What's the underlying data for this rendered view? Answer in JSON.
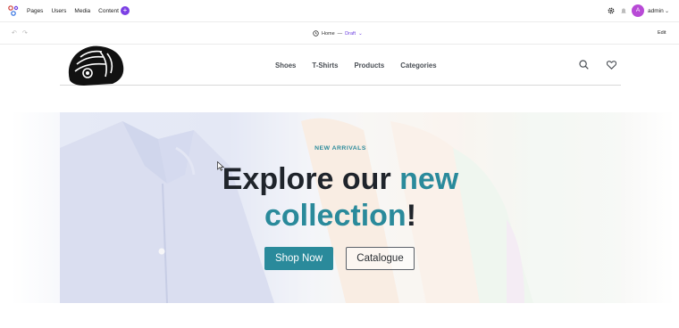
{
  "topbar": {
    "nav": [
      "Pages",
      "Users",
      "Media",
      "Content"
    ],
    "plus_label": "+",
    "avatar_initial": "A",
    "user_label": "admin"
  },
  "editorbar": {
    "page_name": "Home",
    "separator": "—",
    "status": "Draft",
    "edit_label": "Edit"
  },
  "site": {
    "nav": [
      "Shoes",
      "T-Shirts",
      "Products",
      "Categories"
    ]
  },
  "hero": {
    "kicker": "NEW ARRIVALS",
    "headline_part1": "Explore our ",
    "headline_accent1": "new",
    "headline_accent2": "collection",
    "headline_end": "!",
    "primary_button": "Shop Now",
    "secondary_button": "Catalogue"
  },
  "colors": {
    "accent": "#2a8a9b",
    "admin_accent": "#7b3fe4",
    "avatar": "#b84ad6"
  }
}
